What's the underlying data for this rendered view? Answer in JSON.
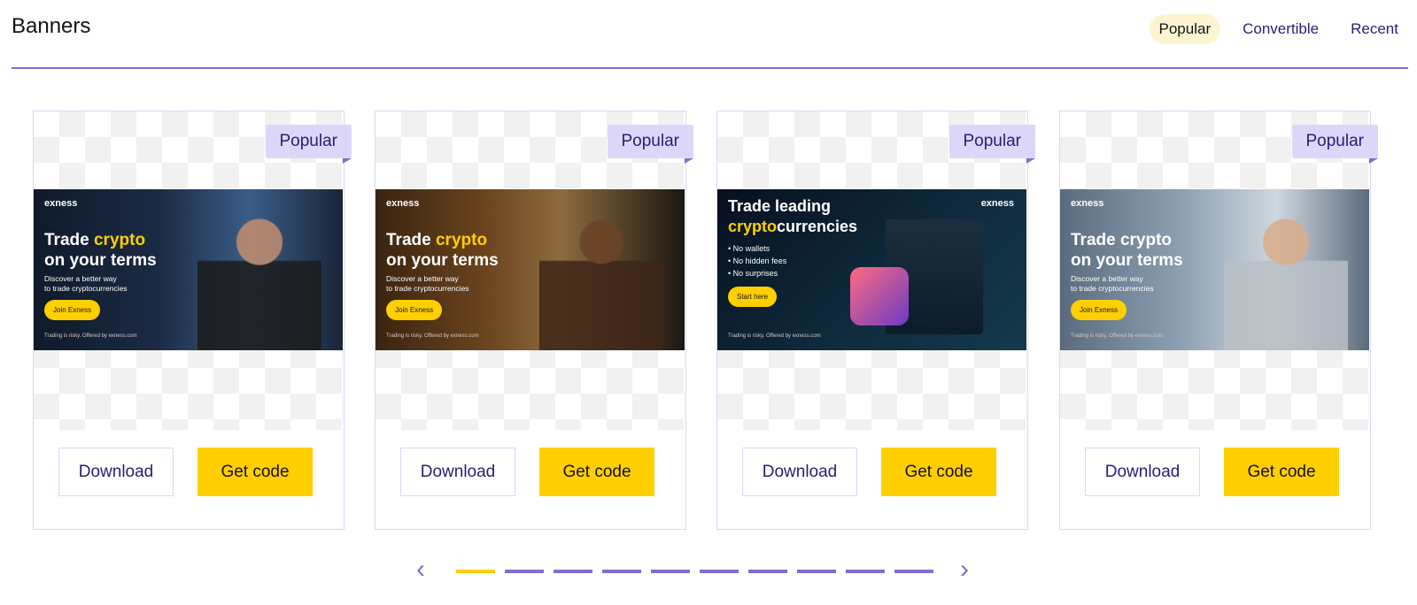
{
  "header": {
    "title": "Banners",
    "tabs": [
      {
        "label": "Popular",
        "active": true
      },
      {
        "label": "Convertible",
        "active": false
      },
      {
        "label": "Recent",
        "active": false
      }
    ]
  },
  "cards": [
    {
      "badge": "Popular",
      "banner": {
        "brand": "exness",
        "line1": "Trade ",
        "highlight": "crypto",
        "line2": "on your terms",
        "sub1": "Discover a better way",
        "sub2": "to trade cryptocurrencies",
        "cta": "Join Exness",
        "footer": "Trading is risky. Offered by exness.com"
      },
      "download": "Download",
      "get_code": "Get code"
    },
    {
      "badge": "Popular",
      "banner": {
        "brand": "exness",
        "line1": "Trade ",
        "highlight": "crypto",
        "line2": "on your terms",
        "sub1": "Discover a better way",
        "sub2": "to trade cryptocurrencies",
        "cta": "Join Exness",
        "footer": "Trading is risky. Offered by exness.com"
      },
      "download": "Download",
      "get_code": "Get code"
    },
    {
      "badge": "Popular",
      "banner": {
        "brand": "exness",
        "line1": "Trade leading",
        "highlight": "crypto",
        "line2rest": "currencies",
        "bullets": [
          "• No wallets",
          "• No hidden fees",
          "• No surprises"
        ],
        "cta": "Start here",
        "footer": "Trading is risky. Offered by exness.com"
      },
      "download": "Download",
      "get_code": "Get code"
    },
    {
      "badge": "Popular",
      "banner": {
        "brand": "exness",
        "line1": "Trade crypto",
        "line2": "on your terms",
        "sub1": "Discover a better way",
        "sub2": "to trade cryptocurrencies",
        "cta": "Join Exness",
        "footer": "Trading is risky. Offered by exness.com"
      },
      "download": "Download",
      "get_code": "Get code"
    }
  ],
  "pager": {
    "prev_icon": "chevron-left-icon",
    "next_icon": "chevron-right-icon",
    "pages": 10,
    "current": 1,
    "prev_glyph": "‹",
    "next_glyph": "›"
  },
  "colors": {
    "accent": "#7d6fd0",
    "primary_text": "#2c1b76",
    "yellow": "#ffcf00",
    "badge_bg": "#dcd7f8",
    "tab_active_bg": "#fdf4d2"
  }
}
